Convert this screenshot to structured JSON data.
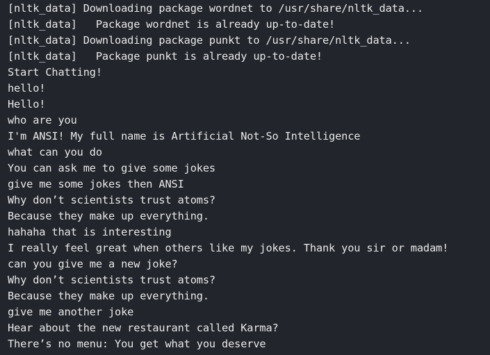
{
  "terminal": {
    "lines": [
      "[nltk_data] Downloading package wordnet to /usr/share/nltk_data...",
      "[nltk_data]   Package wordnet is already up-to-date!",
      "[nltk_data] Downloading package punkt to /usr/share/nltk_data...",
      "[nltk_data]   Package punkt is already up-to-date!",
      "Start Chatting!",
      "hello!",
      "Hello!",
      "who are you",
      "I'm ANSI! My full name is Artificial Not-So Intelligence",
      "what can you do",
      "You can ask me to give some jokes",
      "give me some jokes then ANSI",
      "Why don’t scientists trust atoms?",
      "Because they make up everything.",
      "hahaha that is interesting",
      "I really feel great when others like my jokes. Thank you sir or madam!",
      "can you give me a new joke?",
      "Why don’t scientists trust atoms?",
      "Because they make up everything.",
      "give me another joke",
      "Hear about the new restaurant called Karma?",
      "There’s no menu: You get what you deserve"
    ]
  }
}
